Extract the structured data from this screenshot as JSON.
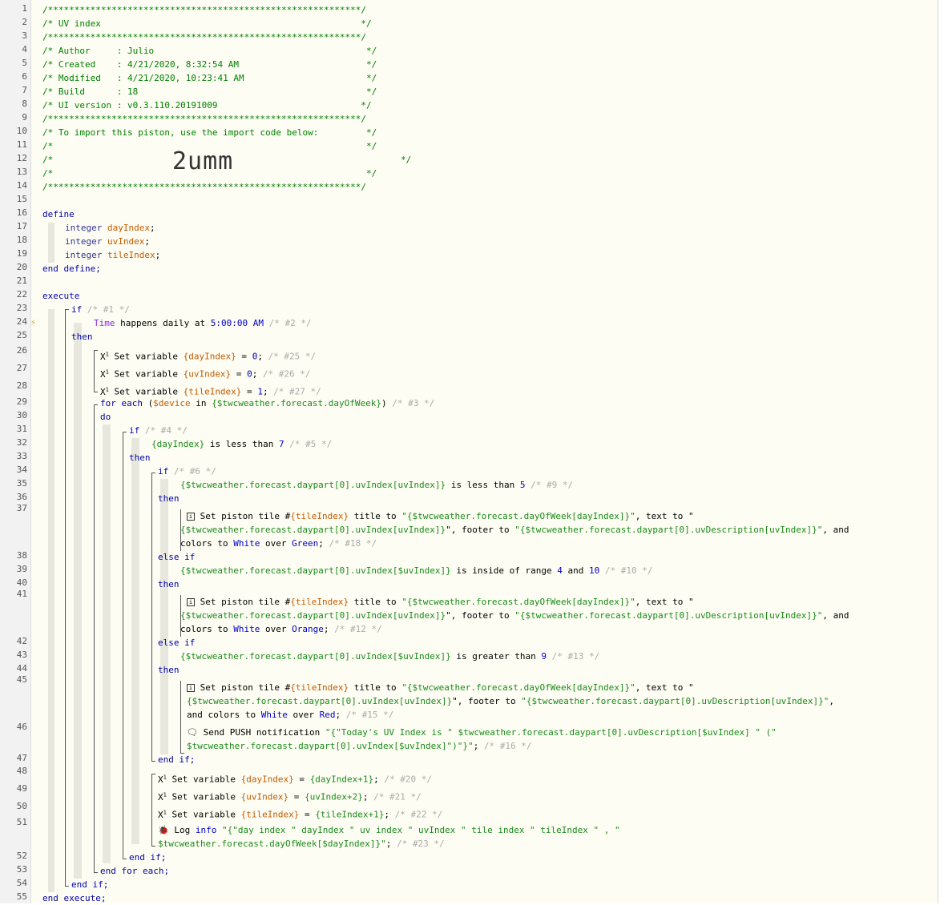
{
  "header": {
    "border": "/***********************************************************/",
    "title_line": "/* UV index                                                 */",
    "author_line": "/* Author     : Julio                                        */",
    "created_line": "/* Created    : 4/21/2020, 8:32:54 AM                        */",
    "modified_line": "/* Modified   : 4/21/2020, 10:23:41 AM                       */",
    "build_line": "/* Build      : 18                                           */",
    "ui_line": "/* UI version : v0.3.110.20191009                           */",
    "import_line": "/* To import this piston, use the import code below:         */",
    "empty_line": "/*                                                           */",
    "code_line_prefix": "/*",
    "code_line_suffix": "*/",
    "import_code": "2umm"
  },
  "kw": {
    "define": "define",
    "integer": "integer",
    "end_define": "end define;",
    "execute": "execute",
    "if": "if",
    "then": "then",
    "else_if": "else if",
    "end_if": "end if;",
    "for_each": "for each",
    "do": "do",
    "end_for_each": "end for each;",
    "end_execute": "end execute;",
    "in": "in",
    "and": "and"
  },
  "vars": {
    "dayIndex": "dayIndex",
    "uvIndex": "uvIndex",
    "tileIndex": "tileIndex",
    "device": "$device"
  },
  "code": {
    "c1": "/* #1 */",
    "time": "Time",
    "happens_daily_at": "happens daily at",
    "time_value": "5:00:00 AM",
    "c2": "/* #2 */",
    "set_variable": "Set variable",
    "dayIndex_ref": "{dayIndex}",
    "uvIndex_ref": "{uvIndex}",
    "tileIndex_ref": "{tileIndex}",
    "eq": " = ",
    "zero": "0",
    "one": "1",
    "semi": ";",
    "c25": "/* #25 */",
    "c26": "/* #26 */",
    "c27": "/* #27 */",
    "for_expr": "{$twcweather.forecast.dayOfWeek}",
    "c3": "/* #3 */",
    "c4": "/* #4 */",
    "is_less_than": "is less than",
    "seven": "7",
    "c5": "/* #5 */",
    "c6": "/* #6 */",
    "uv_expr_uvIndex": "{$twcweather.forecast.daypart[0].uvIndex[uvIndex]}",
    "uv_expr_suvIndex": "{$twcweather.forecast.daypart[0].uvIndex[$uvIndex]}",
    "five": "5",
    "c9": "/* #9 */",
    "set_piston_tile": "Set piston tile #",
    "title_to": "title to",
    "title_expr": "\"{$twcweather.forecast.dayOfWeek[dayIndex]}\"",
    "text_to": ", text to \"",
    "text_expr": "{$twcweather.forecast.daypart[0].uvIndex[uvIndex]}",
    "footer_to": "\", footer to",
    "footer_expr": "\"{$twcweather.forecast.daypart[0].uvDescription[uvIndex]}\"",
    "and_colors_to": ", and",
    "colors_to": "colors to",
    "and_colors_to_full": "and colors to",
    "white": "White",
    "over": "over",
    "green": "Green",
    "orange": "Orange",
    "red": "Red",
    "c18": "/* #18 */",
    "is_inside_range": "is inside of range",
    "four": "4",
    "ten": "10",
    "c10": "/* #10 */",
    "c12": "/* #12 */",
    "is_greater_than": "is greater than",
    "nine": "9",
    "c13": "/* #13 */",
    "c15": "/* #15 */",
    "send_push": "Send PUSH notification",
    "push_expr_1": "\"{\"Today's UV Index is \" $twcweather.forecast.daypart[0].uvDescription[$uvIndex] \" (\"",
    "push_expr_2": "$twcweather.forecast.daypart[0].uvIndex[$uvIndex]\")\"}\"",
    "c16": "/* #16 */",
    "dayIndex_plus": "{dayIndex+1}",
    "uvIndex_plus": "{uvIndex+2}",
    "tileIndex_plus": "{tileIndex+1}",
    "c20": "/* #20 */",
    "c21": "/* #21 */",
    "c22": "/* #22 */",
    "log": "Log",
    "info": "info",
    "log_expr_1": "\"{\"day index \" dayIndex \" uv index \" uvIndex \" tile index \" tileIndex \" , \"",
    "log_expr_2": "$twcweather.forecast.dayOfWeek[$dayIndex]}\"",
    "c23": "/* #23 */"
  },
  "line_numbers": [
    "1",
    "2",
    "3",
    "4",
    "5",
    "6",
    "7",
    "8",
    "9",
    "10",
    "11",
    "12",
    "13",
    "14",
    "15",
    "16",
    "17",
    "18",
    "19",
    "20",
    "21",
    "22",
    "23",
    "24",
    "25",
    "26",
    "27",
    "28",
    "29",
    "30",
    "31",
    "32",
    "33",
    "34",
    "35",
    "36",
    "37",
    "38",
    "39",
    "40",
    "41",
    "42",
    "43",
    "44",
    "45",
    "46",
    "47",
    "48",
    "49",
    "50",
    "51",
    "52",
    "53",
    "54",
    "55"
  ]
}
